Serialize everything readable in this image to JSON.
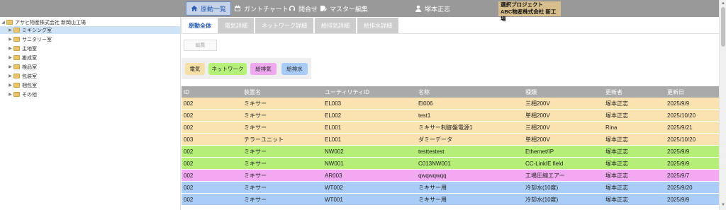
{
  "nav": {
    "items": [
      {
        "label": "原動一覧",
        "icon": "home-icon"
      },
      {
        "label": "ガントチャート",
        "icon": "calendar-icon"
      },
      {
        "label": "問合せ",
        "icon": "headset-icon"
      },
      {
        "label": "マスター編集",
        "icon": "edit-icon"
      }
    ],
    "user": "塚本正志",
    "project_line1": "選択プロジェクト",
    "project_line2": "ABC物産株式会社 新工場"
  },
  "tree": {
    "root": "アサヒ物産株式会社 新岡山工場",
    "items": [
      "ミキシング室",
      "サニタリー室",
      "主地室",
      "搬成室",
      "検品室",
      "包装室",
      "梱包室",
      "その他"
    ],
    "selected": "ミキシング室"
  },
  "tabs": [
    "原動全体",
    "電気詳細",
    "ネットワーク詳細",
    "給排気詳細",
    "給排水詳細"
  ],
  "active_tab": "原動全体",
  "edit_button": "編集",
  "filters": [
    {
      "label": "電気",
      "color": "#f7e0a8"
    },
    {
      "label": "ネットワーク",
      "color": "#b5f07a"
    },
    {
      "label": "給排気",
      "color": "#f0a8f0"
    },
    {
      "label": "給排水",
      "color": "#a8ccf7"
    }
  ],
  "table": {
    "headers": [
      "ID",
      "装置名",
      "ユーティリティID",
      "名称",
      "種類",
      "更新者",
      "更新日"
    ],
    "rows": [
      {
        "cells": [
          "002",
          "ミキサー",
          "EL003",
          "El006",
          "三相200V",
          "塚本正志",
          "2025/9/9"
        ],
        "color": "#fae3b0"
      },
      {
        "cells": [
          "002",
          "ミキサー",
          "EL002",
          "test1",
          "単相200V",
          "塚本正志",
          "2025/10/20"
        ],
        "color": "#fae3b0"
      },
      {
        "cells": [
          "002",
          "ミキサー",
          "EL001",
          "ミキサー制御盤電源1",
          "三相200V",
          "Rina",
          "2025/9/21"
        ],
        "color": "#fae3b0"
      },
      {
        "cells": [
          "003",
          "チラーユニット",
          "EL001",
          "ダミーデータ",
          "単相200V",
          "塚本正志",
          "2025/10/20"
        ],
        "color": "#fae3b0"
      },
      {
        "cells": [
          "002",
          "ミキサー",
          "NW002",
          "testtestest",
          "Ethernet/IP",
          "塚本正志",
          "2025/9/9"
        ],
        "color": "#b6ef78"
      },
      {
        "cells": [
          "002",
          "ミキサー",
          "NW001",
          "C013NW001",
          "CC-LinkIE field",
          "塚本正志",
          "2025/9/9"
        ],
        "color": "#b6ef78"
      },
      {
        "cells": [
          "002",
          "ミキサー",
          "AR003",
          "qwqwqwqq",
          "工場圧縮エアー",
          "塚本正志",
          "2025/9/7"
        ],
        "color": "#f2a9f2"
      },
      {
        "cells": [
          "002",
          "ミキサー",
          "WT002",
          "ミキサー用",
          "冷却水(10度)",
          "塚本正志",
          "2025/9/20"
        ],
        "color": "#a9cdf6"
      },
      {
        "cells": [
          "002",
          "ミキサー",
          "WT001",
          "ミキサー用",
          "冷却水(10度)",
          "塚本正志",
          "2025/9/9"
        ],
        "color": "#a9cdf6"
      }
    ]
  }
}
